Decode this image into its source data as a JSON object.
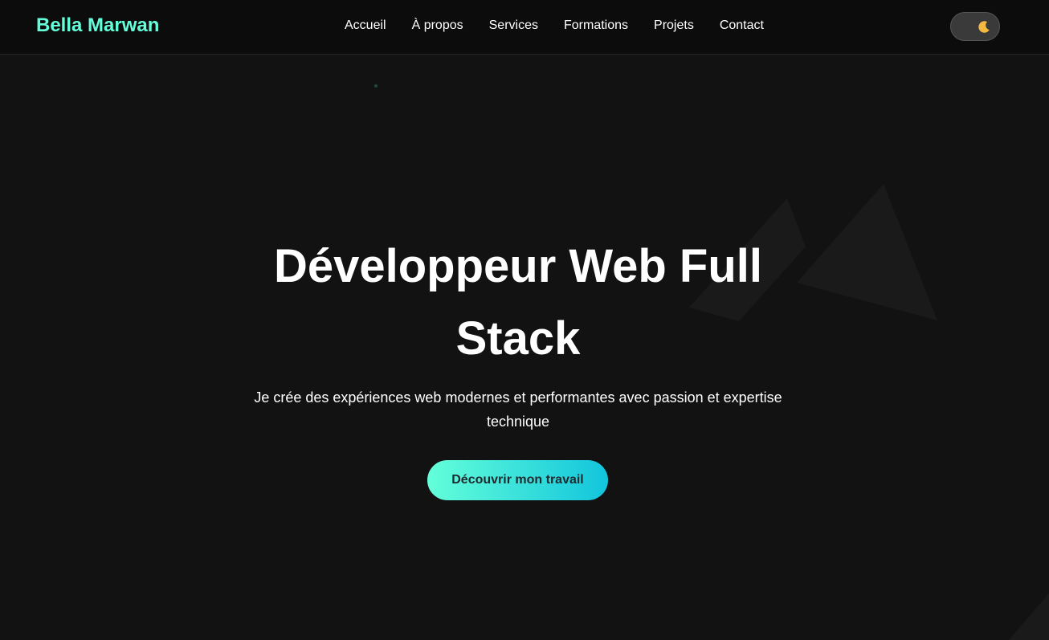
{
  "header": {
    "brand": "Bella Marwan",
    "nav": [
      {
        "label": "Accueil"
      },
      {
        "label": "À propos"
      },
      {
        "label": "Services"
      },
      {
        "label": "Formations"
      },
      {
        "label": "Projets"
      },
      {
        "label": "Contact"
      }
    ],
    "theme_toggle": {
      "icon": "moon-icon",
      "mode": "dark"
    }
  },
  "hero": {
    "title": "Développeur Web Full Stack",
    "subtitle": "Je crée des expériences web modernes et performantes avec passion et expertise technique",
    "cta_label": "Découvrir mon travail"
  },
  "colors": {
    "accent": "#64ffda",
    "accent_end": "#12c5dc",
    "background": "#121212",
    "nav_background": "#0c0c0c"
  }
}
